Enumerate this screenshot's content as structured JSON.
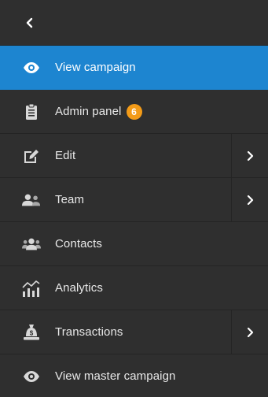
{
  "colors": {
    "background": "#2f2f2f",
    "active": "#1d85d0",
    "badge": "#f39b18",
    "text": "#e9e9e9",
    "icon": "#d8d8d8"
  },
  "back": {
    "icon": "chevron-left-icon"
  },
  "items": [
    {
      "label": "View campaign",
      "icon": "eye-icon",
      "active": true
    },
    {
      "label": "Admin panel",
      "icon": "clipboard-icon",
      "badge": "6"
    },
    {
      "label": "Edit",
      "icon": "edit-icon",
      "submenu": true
    },
    {
      "label": "Team",
      "icon": "team-icon",
      "submenu": true
    },
    {
      "label": "Contacts",
      "icon": "contacts-icon"
    },
    {
      "label": "Analytics",
      "icon": "analytics-icon"
    },
    {
      "label": "Transactions",
      "icon": "money-bag-icon",
      "submenu": true
    },
    {
      "label": "View master campaign",
      "icon": "eye-icon"
    }
  ]
}
